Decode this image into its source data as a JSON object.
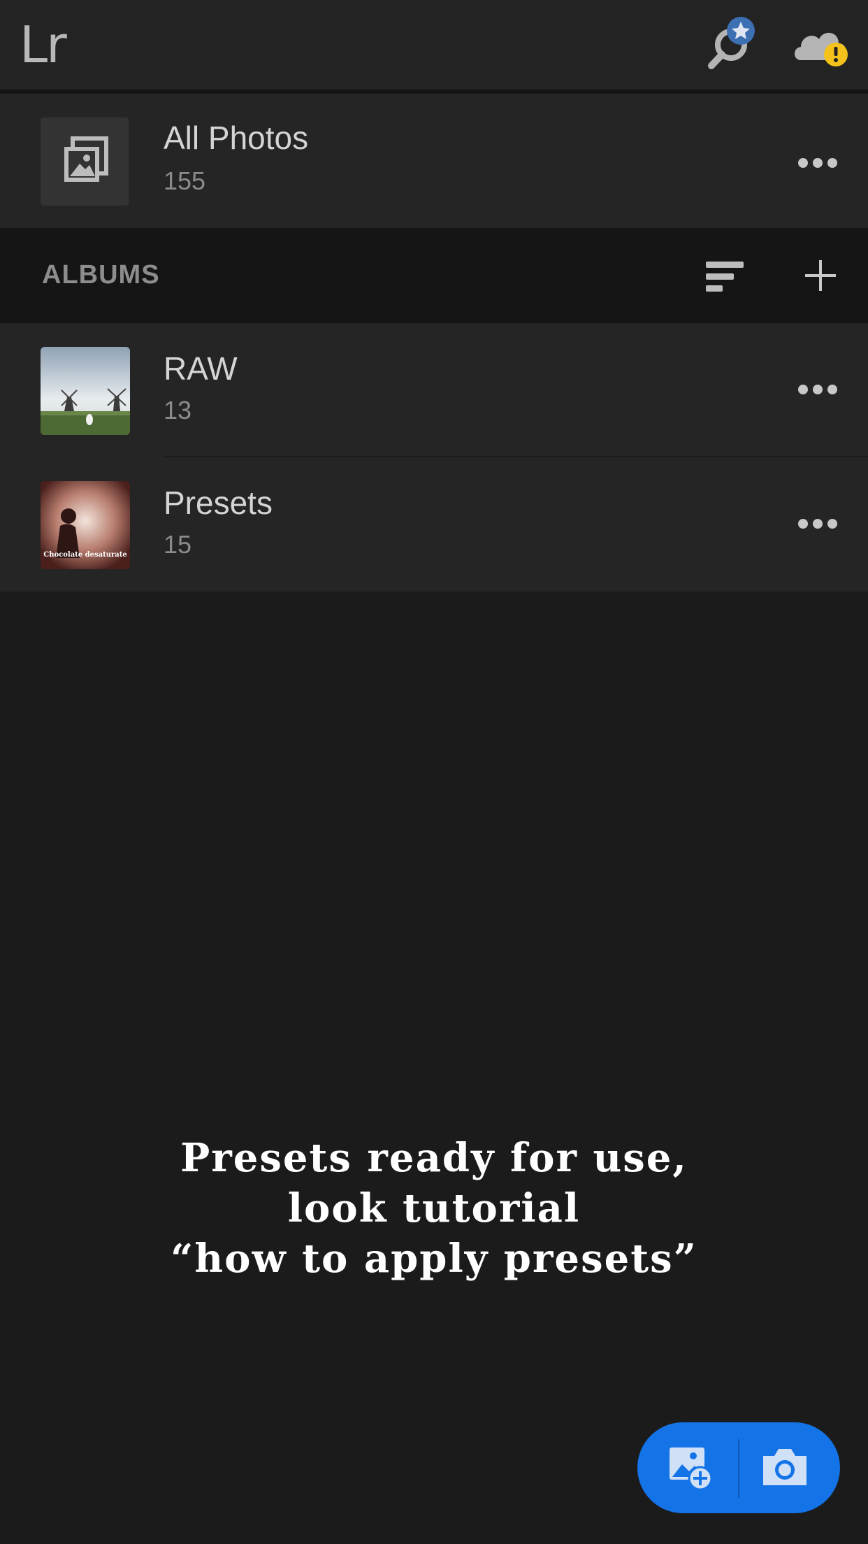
{
  "header": {
    "logo": "Lr"
  },
  "all_photos": {
    "title": "All Photos",
    "count": "155"
  },
  "albums_section": {
    "label": "ALBUMS"
  },
  "albums": [
    {
      "title": "RAW",
      "count": "13"
    },
    {
      "title": "Presets",
      "count": "15",
      "thumb_caption": "Chocolate desaturate"
    }
  ],
  "overlay": {
    "line1": "Presets ready for use,",
    "line2": "look tutorial",
    "line3": "“how to apply presets”"
  },
  "colors": {
    "accent": "#1473e6",
    "badge_star": "#3d6fb3",
    "warning": "#f4c21a"
  },
  "icons": {
    "search": "search-star-icon",
    "cloud": "cloud-warning-icon",
    "sort": "sort-icon",
    "add": "plus-icon",
    "add_photo": "add-photo-icon",
    "camera": "camera-icon"
  }
}
